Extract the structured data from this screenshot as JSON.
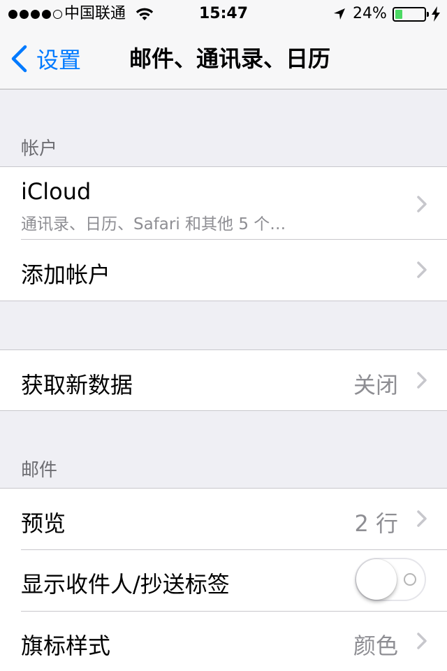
{
  "status_bar": {
    "carrier": "中国联通",
    "time": "15:47",
    "battery_percent": "24%",
    "battery_level": 0.24,
    "signal_bars_filled": 4,
    "battery_color": "#4cd964"
  },
  "nav": {
    "back_label": "设置",
    "title": "邮件、通讯录、日历",
    "accent": "#007aff"
  },
  "sections": {
    "accounts": {
      "header": "帐户",
      "icloud_title": "iCloud",
      "icloud_subtitle": "通讯录、日历、Safari 和其他 5 个…",
      "add_account": "添加帐户"
    },
    "fetch": {
      "title": "获取新数据",
      "value": "关闭"
    },
    "mail": {
      "header": "邮件",
      "preview_title": "预览",
      "preview_value": "2 行",
      "show_to_cc_title": "显示收件人/抄送标签",
      "show_to_cc_on": false,
      "flag_style_title": "旗标样式",
      "flag_style_value": "颜色"
    }
  }
}
